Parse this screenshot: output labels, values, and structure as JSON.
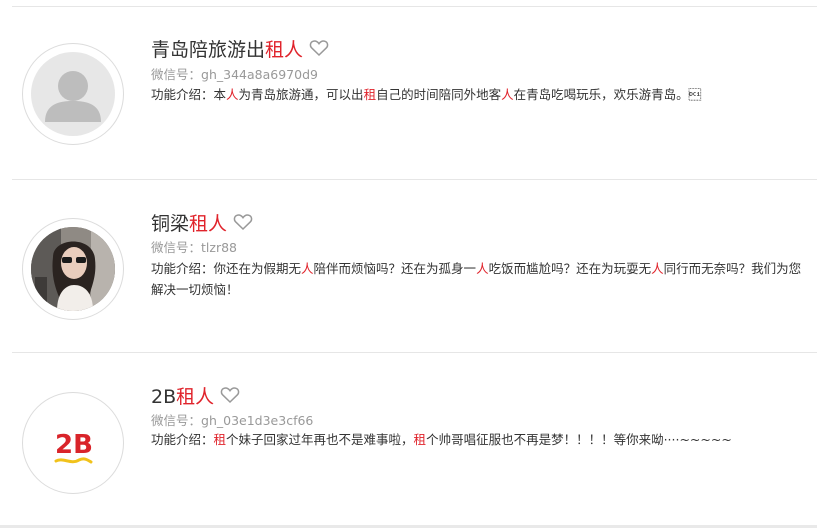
{
  "accounts": [
    {
      "name_prefix": "青岛陪旅游出",
      "name_keyword": "租人",
      "wechat_label": "微信号：",
      "wechat_id": "gh_344a8a6970d9",
      "intro_label": "功能介绍：",
      "intro_segments": [
        {
          "text": "本",
          "hl": false
        },
        {
          "text": "人",
          "hl": true
        },
        {
          "text": "为青岛旅游通，可以出",
          "hl": false
        },
        {
          "text": "租",
          "hl": true
        },
        {
          "text": "自己的时间陪同外地客",
          "hl": false
        },
        {
          "text": "人",
          "hl": true
        },
        {
          "text": "在青岛吃喝玩乐，欢乐游青岛。\u0011",
          "hl": false
        }
      ],
      "avatar": "default-user-icon"
    },
    {
      "name_prefix": "铜梁",
      "name_keyword": "租人",
      "wechat_label": "微信号：",
      "wechat_id": "tlzr88",
      "intro_label": "功能介绍：",
      "intro_segments": [
        {
          "text": "你还在为假期无",
          "hl": false
        },
        {
          "text": "人",
          "hl": true
        },
        {
          "text": "陪伴而烦恼吗？还在为孤身一",
          "hl": false
        },
        {
          "text": "人",
          "hl": true
        },
        {
          "text": "吃饭而尴尬吗？还在为玩耍无",
          "hl": false
        },
        {
          "text": "人",
          "hl": true
        },
        {
          "text": "同行而无奈吗？我们为您解决一切烦恼！",
          "hl": false
        }
      ],
      "avatar": "girl-photo"
    },
    {
      "name_prefix": "2B",
      "name_keyword": "租人",
      "wechat_label": "微信号：",
      "wechat_id": "gh_03e1d3e3cf66",
      "intro_label": "功能介绍：",
      "intro_segments": [
        {
          "text": "租",
          "hl": true
        },
        {
          "text": "个妹子回家过年再也不是难事啦，",
          "hl": false
        },
        {
          "text": "租",
          "hl": true
        },
        {
          "text": "个帅哥唱征服也不再是梦！！！！等你来呦····~~~~~",
          "hl": false
        }
      ],
      "avatar": "2b-logo",
      "logo_text": "2B"
    }
  ],
  "colors": {
    "highlight": "#e0232b",
    "muted": "#999999",
    "text": "#333333"
  }
}
